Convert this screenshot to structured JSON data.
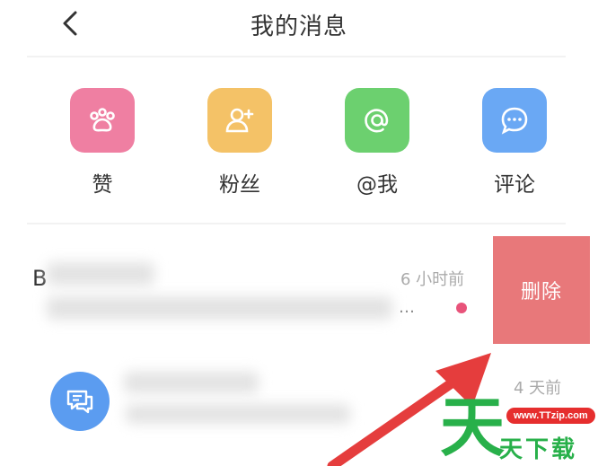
{
  "header": {
    "title": "我的消息"
  },
  "quick_actions": [
    {
      "label": "赞",
      "icon": "paw-icon",
      "color": "#ef7fa2"
    },
    {
      "label": "粉丝",
      "icon": "add-user-icon",
      "color": "#f4c267"
    },
    {
      "label": "@我",
      "icon": "at-icon",
      "color": "#6cd06f"
    },
    {
      "label": "评论",
      "icon": "comment-icon",
      "color": "#6aa8f4"
    }
  ],
  "messages": [
    {
      "initial": "B",
      "time": "6 小时前",
      "preview_suffix": "…",
      "unread": true,
      "delete_label": "删除"
    },
    {
      "avatar_icon": "chat-bubble-icon",
      "avatar_color": "#5b9cf0",
      "time": "4 天前"
    }
  ],
  "watermark": {
    "brand": "天",
    "url": "www.TTzip.com",
    "text": "天下载"
  },
  "colors": {
    "delete_bg": "#e8787a",
    "unread_dot": "#e8537a",
    "annotation_arrow": "#e53d3d"
  }
}
